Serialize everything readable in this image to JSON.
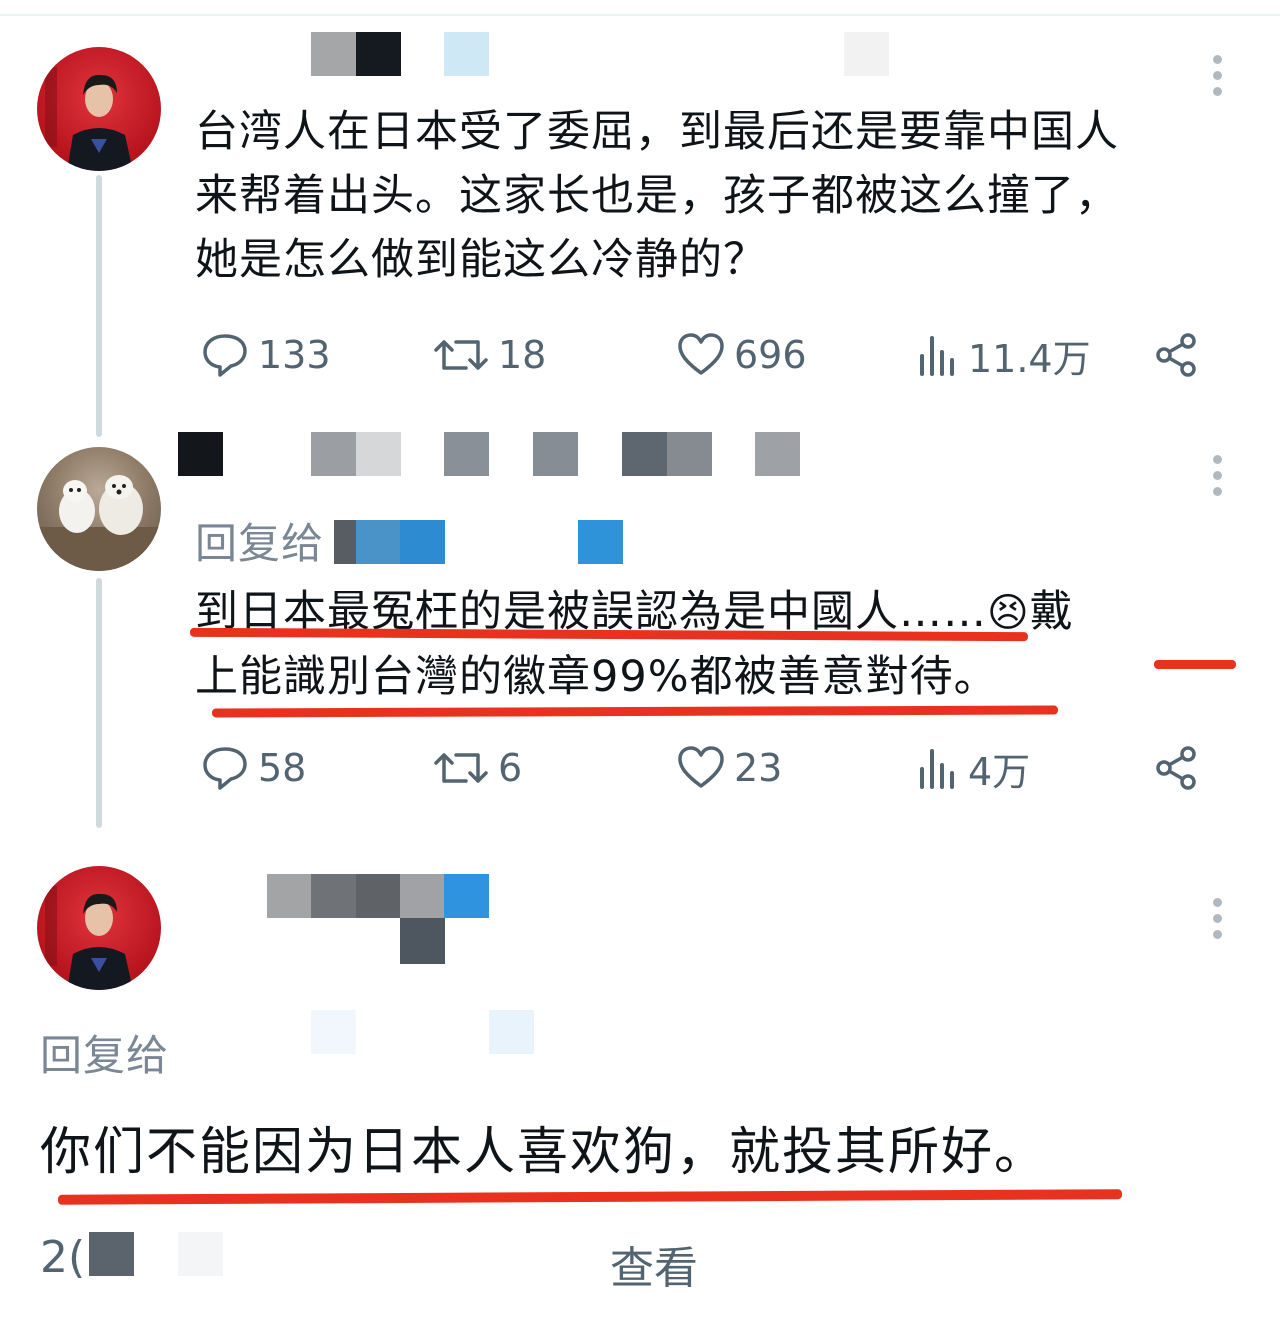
{
  "tweet1": {
    "text_line1": "台湾人在日本受了委屈，到最后还是要靠中国人",
    "text_line2": "来帮着出头。这家长也是，孩子都被这么撞了，",
    "text_line3": "她是怎么做到能这么冷静的？",
    "replies": "133",
    "retweets": "18",
    "likes": "696",
    "views": "11.4万"
  },
  "tweet2": {
    "reply_prefix": "回复给",
    "text_line1a": "到日本最冤枉的是被誤認為是中國人……",
    "emoji": "😣",
    "text_line1b": "戴",
    "text_line2": "上能識別台灣的徽章99%都被善意對待。",
    "replies": "58",
    "retweets": "6",
    "likes": "23",
    "views": "4万"
  },
  "tweet3": {
    "reply_prefix": "回复给",
    "text": "你们不能因为日本人喜欢狗，就投其所好。",
    "footer_partial": "2(",
    "footer_view": "查看"
  },
  "colors": {
    "underline": "#e8321f",
    "muted": "#536471",
    "thread_line": "#cfd9de"
  },
  "icons": [
    "reply-icon",
    "retweet-icon",
    "like-icon",
    "views-icon",
    "share-icon",
    "more-icon"
  ]
}
